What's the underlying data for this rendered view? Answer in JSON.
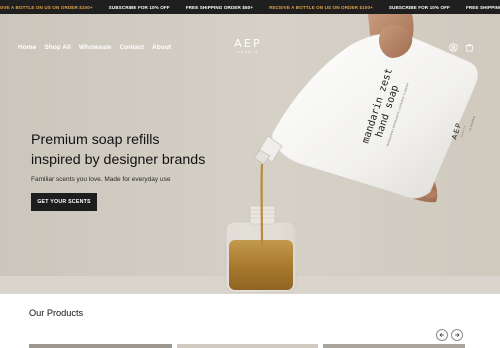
{
  "announcement": {
    "items": [
      {
        "text": "RCEIVE A BOTTLE ON US ON ORDER $100+",
        "accent": true
      },
      {
        "text": "SUBSCRIBE FOR 10% OFF",
        "accent": false
      },
      {
        "text": "FREE SHIPPING ORDER $50+",
        "accent": false
      },
      {
        "text": "RECEIVE A BOTTLE ON US ON ORDER $100+",
        "accent": true
      },
      {
        "text": "SUBSCRIBE FOR 10% OFF",
        "accent": false
      },
      {
        "text": "FREE SHIPPING ORDER $50+",
        "accent": false
      }
    ]
  },
  "nav": {
    "links": [
      "Home",
      "Shop All",
      "Wholesale",
      "Contact",
      "About"
    ],
    "brand": "AEP",
    "brand_sub": "SCENTS",
    "icons": [
      "account-icon",
      "cart-icon"
    ]
  },
  "hero": {
    "title_line1": "Premium soap refills",
    "title_line2": "inspired by designer brands",
    "subtitle": "Familiar scents you love. Made for everyday use",
    "cta": "GET YOUR SCENTS",
    "pouch_label_line1": "mandarin zest",
    "pouch_label_line2": "hand soap",
    "pouch_label_sub": "MANDARIN | BERGAMOT | ORANGE FLOWER",
    "pouch_brand": "AEP",
    "pouch_brand_sub": "SCENTS",
    "pouch_volume": "1 FL OZ | 946 ml"
  },
  "products": {
    "title": "Our Products",
    "prev_icon": "arrow-left-icon",
    "next_icon": "arrow-right-icon"
  },
  "colors": {
    "announcement_bg": "#1f1f1f",
    "announcement_accent": "#e0a24a",
    "cta_bg": "#1d1d1d",
    "soap": "#b08332"
  }
}
